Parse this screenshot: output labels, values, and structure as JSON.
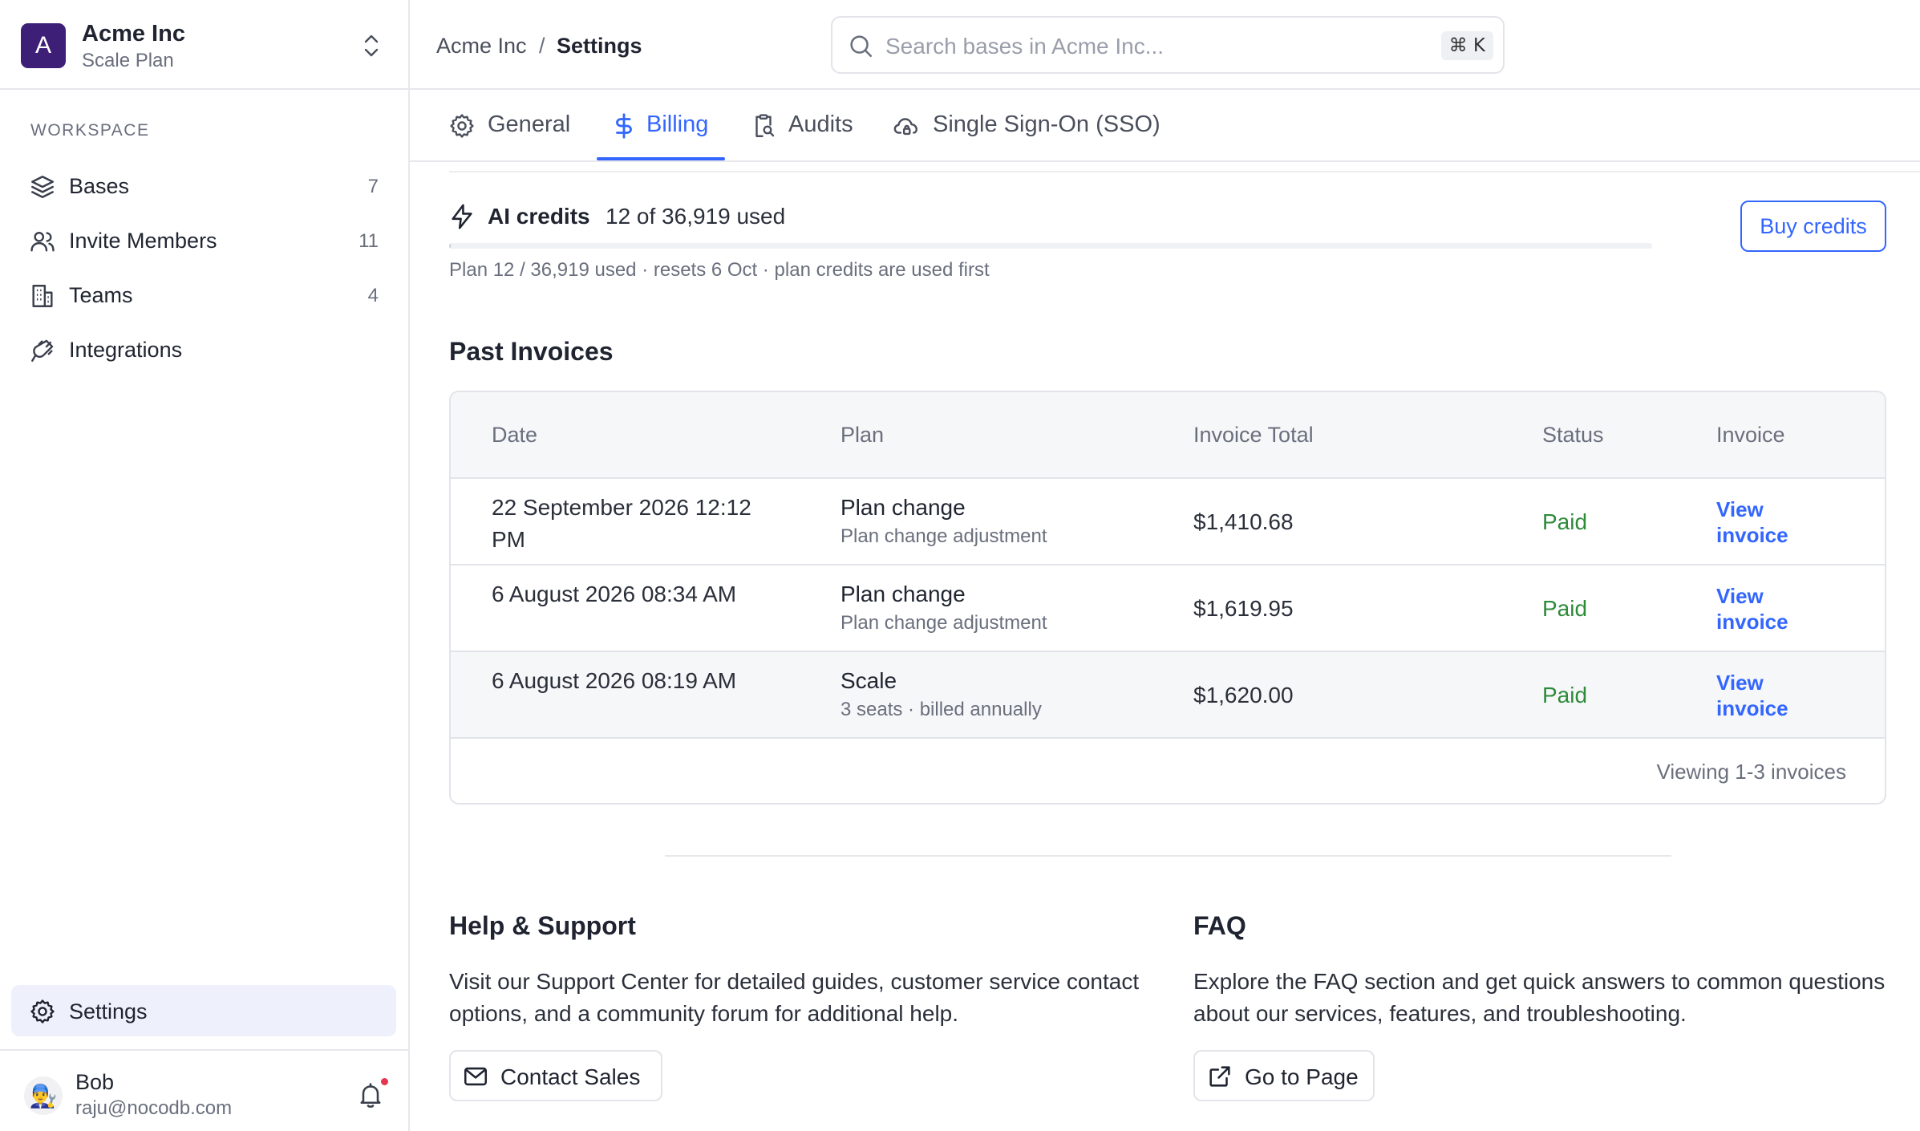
{
  "workspace": {
    "initial": "A",
    "name": "Acme Inc",
    "plan": "Scale Plan"
  },
  "sidebar": {
    "section_label": "WORKSPACE",
    "items": [
      {
        "label": "Bases",
        "count": "7",
        "icon": "layers-icon"
      },
      {
        "label": "Invite Members",
        "count": "11",
        "icon": "users-icon"
      },
      {
        "label": "Teams",
        "count": "4",
        "icon": "building-icon"
      },
      {
        "label": "Integrations",
        "count": "",
        "icon": "plug-icon"
      }
    ],
    "settings_label": "Settings"
  },
  "user": {
    "name": "Bob",
    "email": "raju@nocodb.com",
    "avatar": "👨‍🔧"
  },
  "breadcrumb": {
    "workspace": "Acme Inc",
    "separator": "/",
    "page": "Settings"
  },
  "search": {
    "placeholder": "Search bases in Acme Inc...",
    "shortcut": "⌘ K"
  },
  "tabs": [
    {
      "label": "General",
      "icon": "gear-icon",
      "active": false
    },
    {
      "label": "Billing",
      "icon": "dollar-icon",
      "active": true
    },
    {
      "label": "Audits",
      "icon": "clipboard-search-icon",
      "active": false
    },
    {
      "label": "Single Sign-On (SSO)",
      "icon": "cloud-lock-icon",
      "active": false
    }
  ],
  "credits": {
    "title": "AI credits",
    "usage": "12 of 36,919 used",
    "used": 12,
    "total": 36919,
    "note": "Plan 12 / 36,919 used · resets 6 Oct · plan credits are used first",
    "buy_label": "Buy credits"
  },
  "invoices": {
    "title": "Past Invoices",
    "columns": [
      "Date",
      "Plan",
      "Invoice Total",
      "Status",
      "Invoice"
    ],
    "rows": [
      {
        "date": "22 September 2026 12:12 PM",
        "plan": "Plan change",
        "plan_sub": "Plan change adjustment",
        "total": "$1,410.68",
        "status": "Paid",
        "link": "View invoice"
      },
      {
        "date": "6 August 2026 08:34 AM",
        "plan": "Plan change",
        "plan_sub": "Plan change adjustment",
        "total": "$1,619.95",
        "status": "Paid",
        "link": "View invoice"
      },
      {
        "date": "6 August 2026 08:19 AM",
        "plan": "Scale",
        "plan_sub": "3 seats · billed annually",
        "total": "$1,620.00",
        "status": "Paid",
        "link": "View invoice"
      }
    ],
    "footer": "Viewing 1-3 invoices"
  },
  "help": {
    "title": "Help & Support",
    "body": "Visit our Support Center for detailed guides, customer service contact options, and a community forum for additional help.",
    "button": "Contact Sales"
  },
  "faq": {
    "title": "FAQ",
    "body": "Explore the FAQ section and get quick answers to common questions about our services, features, and troubleshooting.",
    "button": "Go to Page"
  },
  "colors": {
    "accent": "#3366ff",
    "workspace_avatar": "#3d1f78",
    "paid": "#2e8b3a",
    "active_nav_bg": "#eef0fb",
    "notification_dot": "#e5364f"
  }
}
